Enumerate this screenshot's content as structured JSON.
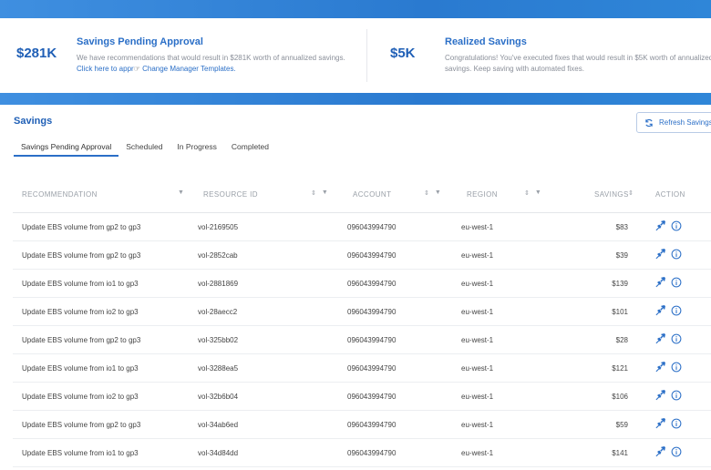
{
  "summary": {
    "pending": {
      "amount": "$281K",
      "title": "Savings Pending Approval",
      "desc": "We have recommendations that would result in $281K worth of annualized savings.",
      "link1": "Click here to appr",
      "link2": "Change Manager Templates."
    },
    "realized": {
      "amount": "$5K",
      "title": "Realized Savings",
      "desc": "Congratulations! You've executed fixes that would result in $5K worth of annualized savings. Keep saving with automated fixes."
    }
  },
  "section_title": "Savings",
  "refresh_label": "Refresh Savings",
  "tabs": [
    "Savings Pending Approval",
    "Scheduled",
    "In Progress",
    "Completed"
  ],
  "columns": {
    "recommendation": "RECOMMENDATION",
    "resource_id": "RESOURCE ID",
    "account": "ACCOUNT",
    "region": "REGION",
    "savings": "SAVINGS",
    "action": "ACTION"
  },
  "rows": [
    {
      "rec": "Update EBS volume from gp2 to gp3",
      "res": "vol-2169505",
      "acc": "096043994790",
      "reg": "eu-west-1",
      "sav": "$83"
    },
    {
      "rec": "Update EBS volume from gp2 to gp3",
      "res": "vol-2852cab",
      "acc": "096043994790",
      "reg": "eu-west-1",
      "sav": "$39"
    },
    {
      "rec": "Update EBS volume from io1 to gp3",
      "res": "vol-2881869",
      "acc": "096043994790",
      "reg": "eu-west-1",
      "sav": "$139"
    },
    {
      "rec": "Update EBS volume from io2 to gp3",
      "res": "vol-28aecc2",
      "acc": "096043994790",
      "reg": "eu-west-1",
      "sav": "$101"
    },
    {
      "rec": "Update EBS volume from gp2 to gp3",
      "res": "vol-325bb02",
      "acc": "096043994790",
      "reg": "eu-west-1",
      "sav": "$28"
    },
    {
      "rec": "Update EBS volume from io1 to gp3",
      "res": "vol-3288ea5",
      "acc": "096043994790",
      "reg": "eu-west-1",
      "sav": "$121"
    },
    {
      "rec": "Update EBS volume from io2 to gp3",
      "res": "vol-32b6b04",
      "acc": "096043994790",
      "reg": "eu-west-1",
      "sav": "$106"
    },
    {
      "rec": "Update EBS volume from gp2 to gp3",
      "res": "vol-34ab6ed",
      "acc": "096043994790",
      "reg": "eu-west-1",
      "sav": "$59"
    },
    {
      "rec": "Update EBS volume from io1 to gp3",
      "res": "vol-34d84dd",
      "acc": "096043994790",
      "reg": "eu-west-1",
      "sav": "$141"
    }
  ],
  "icons": {
    "fix": "rocket-icon",
    "info": "info-icon",
    "filter": "filter-icon",
    "sort": "sort-icon",
    "refresh": "refresh-icon"
  },
  "colors": {
    "accent": "#2b6fc7",
    "band": "#2a7ad0"
  }
}
